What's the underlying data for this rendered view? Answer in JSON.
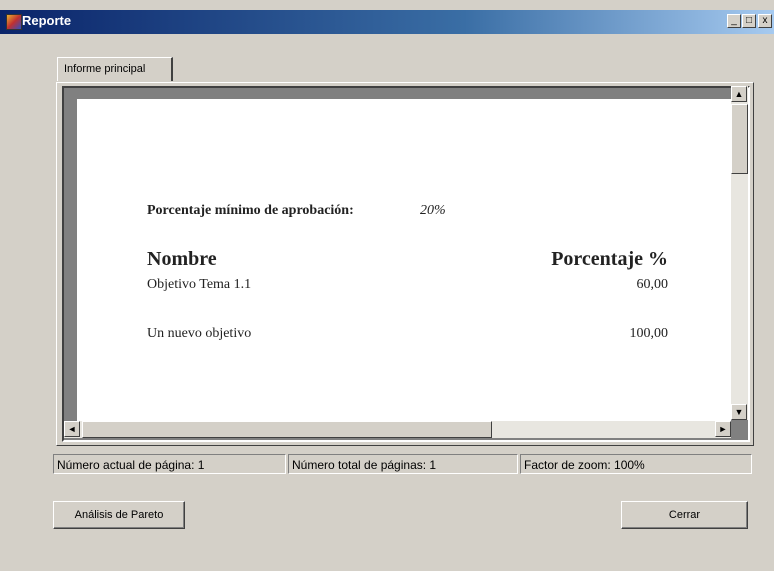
{
  "window": {
    "title": "Reporte"
  },
  "titlebar_buttons": {
    "minimize": "_",
    "maximize": "□",
    "close": "x"
  },
  "tab": {
    "label": "Informe principal"
  },
  "report": {
    "min_label": "Porcentaje mínimo de aprobación:",
    "min_value": "20%",
    "col_name": "Nombre",
    "col_pct": "Porcentaje %",
    "rows": [
      {
        "name": "Objetivo Tema 1.1",
        "pct": "60,00"
      },
      {
        "name": "Un nuevo objetivo",
        "pct": "100,00"
      }
    ]
  },
  "scroll_arrows": {
    "up": "▲",
    "down": "▼",
    "left": "◄",
    "right": "►"
  },
  "status": {
    "current_page": "Número actual de página: 1",
    "total_pages": "Número total de páginas: 1",
    "zoom": "Factor de zoom: 100%"
  },
  "buttons": {
    "pareto": "Análisis de Pareto",
    "close": "Cerrar"
  }
}
